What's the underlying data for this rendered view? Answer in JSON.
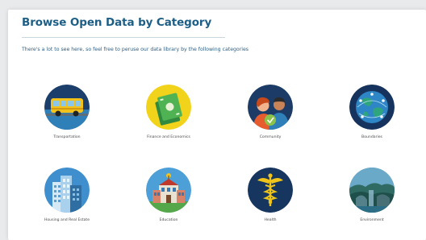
{
  "page": {
    "title": "Browse Open Data by Category",
    "description": "There's a lot to see here, so feel free to peruse our data library by the following categories"
  },
  "categories": [
    {
      "label": "Transportation",
      "icon": "bus-icon"
    },
    {
      "label": "Finance and Economics",
      "icon": "money-icon"
    },
    {
      "label": "Community",
      "icon": "people-icon"
    },
    {
      "label": "Boundaries",
      "icon": "globe-icon"
    },
    {
      "label": "Housing and Real Estate",
      "icon": "buildings-icon"
    },
    {
      "label": "Education",
      "icon": "school-icon"
    },
    {
      "label": "Health",
      "icon": "caduceus-icon"
    },
    {
      "label": "Environment",
      "icon": "landscape-icon"
    }
  ],
  "colors": {
    "title": "#1d5e86",
    "text": "#2d5f86",
    "icon_navy": "#16365f",
    "icon_yellow": "#f0d21a"
  }
}
